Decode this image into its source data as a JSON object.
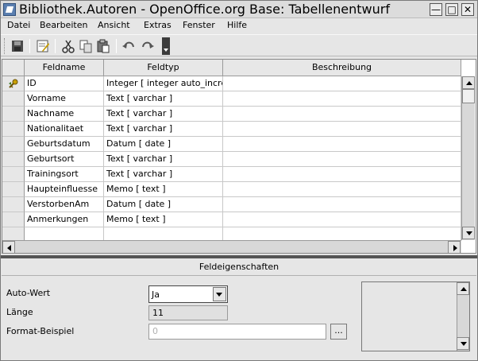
{
  "window": {
    "title": "Bibliothek.Autoren - OpenOffice.org Base: Tabellenentwurf",
    "min_glyph": "—",
    "max_glyph": "□",
    "close_glyph": "✕"
  },
  "menubar": {
    "items": [
      "Datei",
      "Bearbeiten",
      "Ansicht",
      "Extras",
      "Fenster",
      "Hilfe"
    ]
  },
  "toolbar": {
    "buttons": [
      "save-icon",
      "edit-icon",
      "cut-icon",
      "copy-icon",
      "paste-icon",
      "undo-icon",
      "redo-icon"
    ]
  },
  "grid": {
    "columns": [
      "Feldname",
      "Feldtyp",
      "Beschreibung"
    ],
    "rows": [
      {
        "name": "ID",
        "type": "Integer [ integer auto_incre",
        "desc": "",
        "primary_key": true
      },
      {
        "name": "Vorname",
        "type": "Text [ varchar ]",
        "desc": ""
      },
      {
        "name": "Nachname",
        "type": "Text [ varchar ]",
        "desc": ""
      },
      {
        "name": "Nationalitaet",
        "type": "Text [ varchar ]",
        "desc": ""
      },
      {
        "name": "Geburtsdatum",
        "type": "Datum [ date ]",
        "desc": ""
      },
      {
        "name": "Geburtsort",
        "type": "Text [ varchar ]",
        "desc": ""
      },
      {
        "name": "Trainingsort",
        "type": "Text [ varchar ]",
        "desc": ""
      },
      {
        "name": "Haupteinfluesse",
        "type": "Memo [ text ]",
        "desc": ""
      },
      {
        "name": "VerstorbenAm",
        "type": "Datum [ date ]",
        "desc": ""
      },
      {
        "name": "Anmerkungen",
        "type": "Memo [ text ]",
        "desc": ""
      },
      {
        "name": "",
        "type": "",
        "desc": ""
      }
    ]
  },
  "properties": {
    "title": "Feldeigenschaften",
    "auto_value_label": "Auto-Wert",
    "auto_value": "Ja",
    "length_label": "Länge",
    "length_value": "11",
    "format_label": "Format-Beispiel",
    "format_value": "0",
    "format_button": "..."
  },
  "colors": {
    "key_icon": "#c8a000",
    "toolbar_icon": "#4a4a4a"
  }
}
